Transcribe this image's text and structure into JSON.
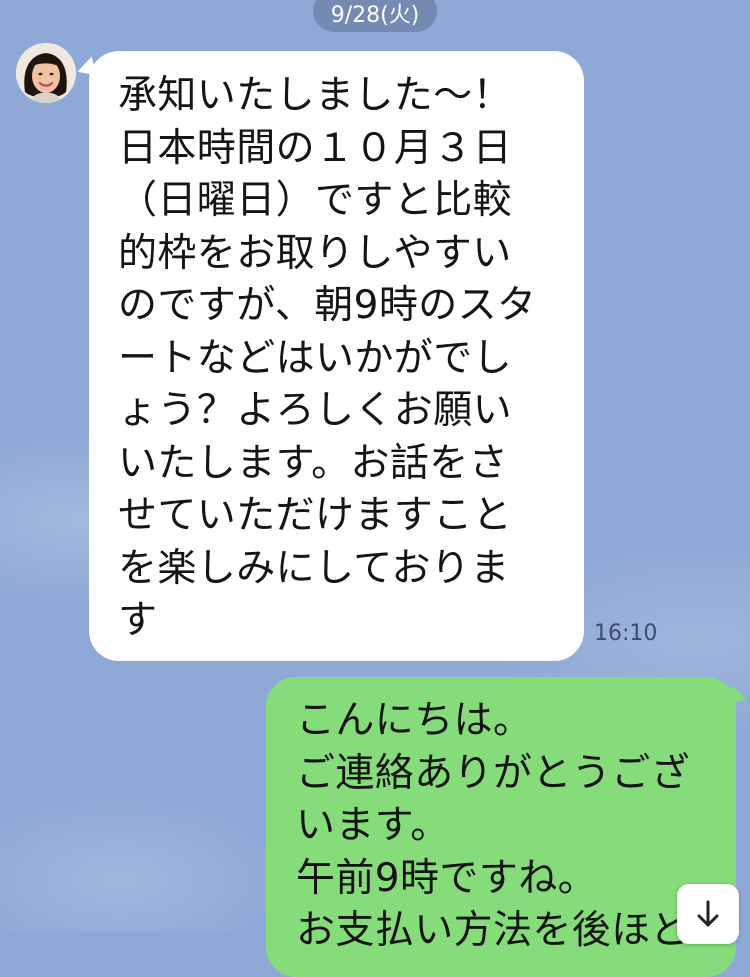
{
  "chat": {
    "date_label": "9/28(火)",
    "incoming": {
      "text": "承知いたしました～！\n日本時間の１０月３日\n（日曜日）ですと比較\n的枠をお取りしやすい\nのですが、朝9時のスタ\nートなどはいかがでし\nょう？よろしくお願い\nいたします。お話をさ\nせていただけますこと\nを楽しみにしておりま\nす",
      "time": "16:10"
    },
    "outgoing": {
      "text": "こんにちは。\nご連絡ありがとうござ\nいます。\n午前9時ですね。\nお支払い方法を後ほど"
    }
  },
  "icons": {
    "avatar": "contact-avatar",
    "scroll": "arrow-down-icon"
  },
  "colors": {
    "background": "#8fa9d6",
    "incoming_bubble": "#ffffff",
    "outgoing_bubble": "#86dc7a"
  }
}
